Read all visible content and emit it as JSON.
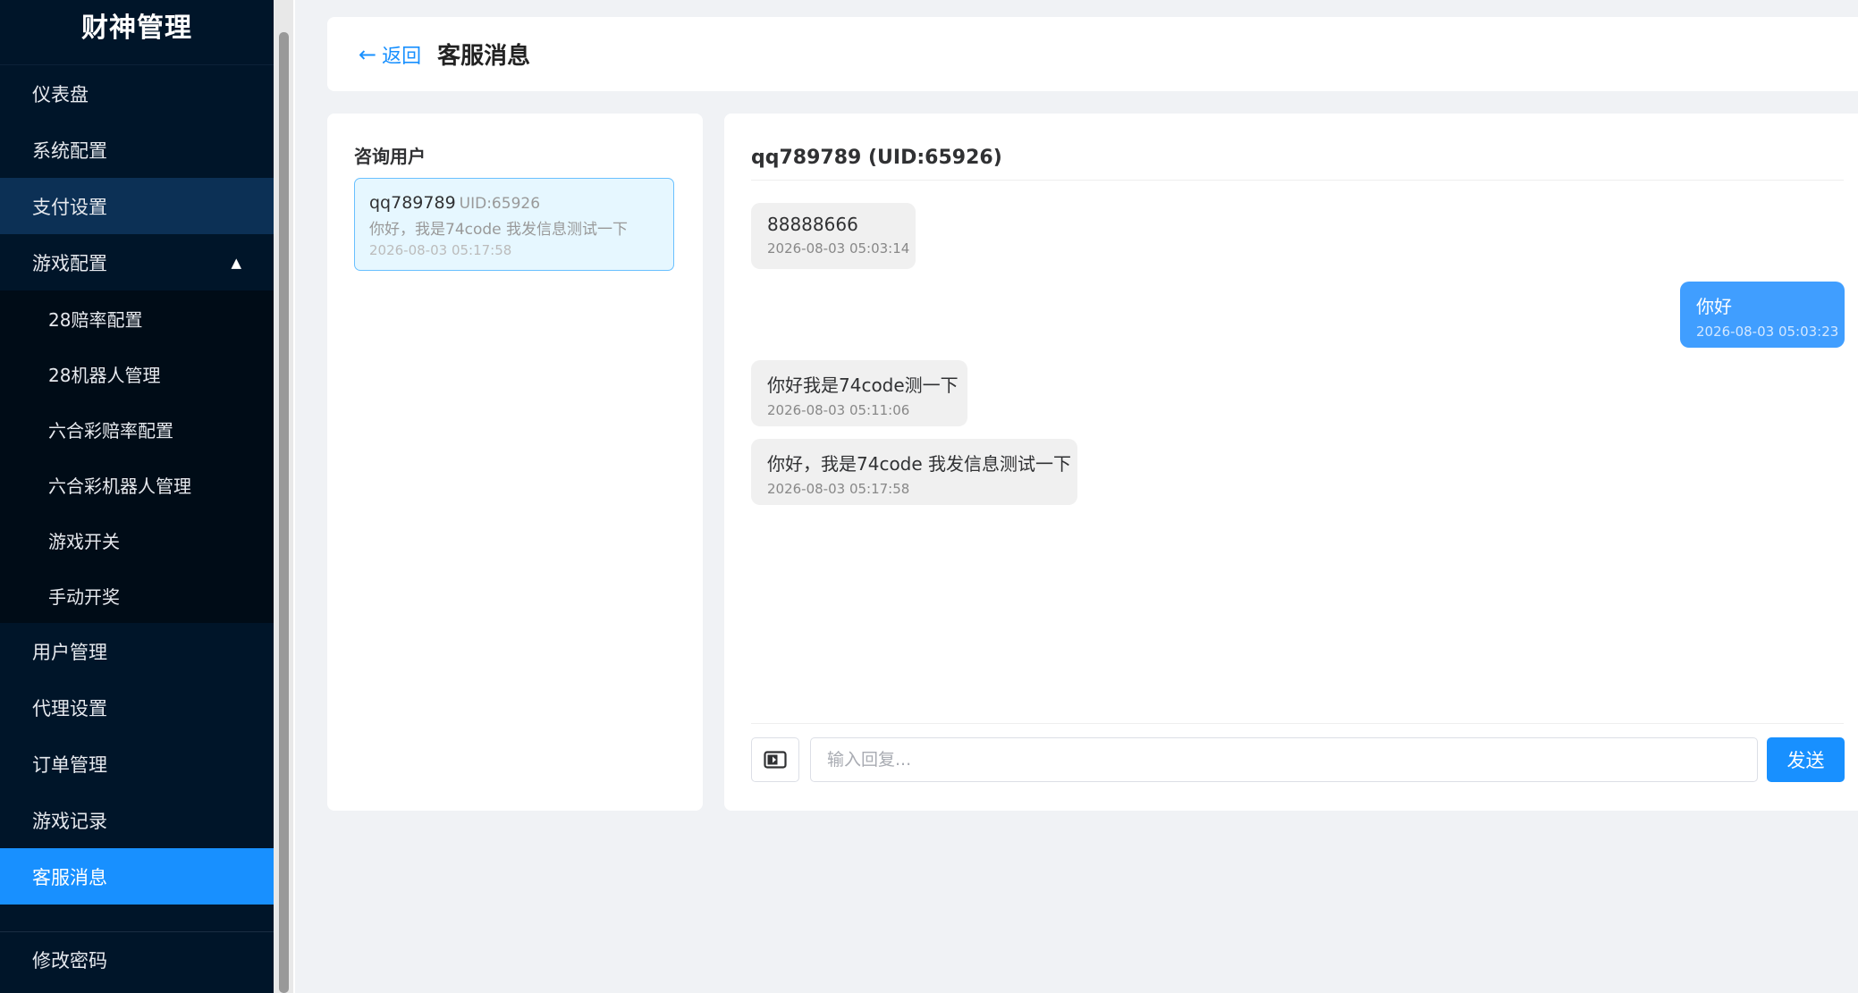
{
  "brand": {
    "title": "财神管理"
  },
  "sidebar": {
    "items": [
      {
        "label": "仪表盘"
      },
      {
        "label": "系统配置"
      },
      {
        "label": "支付设置"
      },
      {
        "label": "游戏配置",
        "caret": "▲"
      },
      {
        "label": "28赔率配置"
      },
      {
        "label": "28机器人管理"
      },
      {
        "label": "六合彩赔率配置"
      },
      {
        "label": "六合彩机器人管理"
      },
      {
        "label": "游戏开关"
      },
      {
        "label": "手动开奖"
      },
      {
        "label": "用户管理"
      },
      {
        "label": "代理设置"
      },
      {
        "label": "订单管理"
      },
      {
        "label": "游戏记录"
      },
      {
        "label": "客服消息"
      },
      {
        "label": "修改密码"
      }
    ]
  },
  "topbar": {
    "back_arrow": "←",
    "back_label": "返回",
    "title": "客服消息"
  },
  "users_panel": {
    "title": "咨询用户",
    "users": [
      {
        "name": "qq789789",
        "uid": "UID:65926",
        "preview": "你好，我是74code 我发信息测试一下",
        "time": "2026-08-03 05:17:58"
      }
    ]
  },
  "chat": {
    "header": "qq789789 (UID:65926)",
    "messages": [
      {
        "direction": "in",
        "text": "88888666",
        "time": "2026-08-03 05:03:14"
      },
      {
        "direction": "out",
        "text": "你好",
        "time": "2026-08-03 05:03:23"
      },
      {
        "direction": "in",
        "text": "你好我是74code测一下",
        "time": "2026-08-03 05:11:06"
      },
      {
        "direction": "in",
        "text": "你好，我是74code 我发信息测试一下",
        "time": "2026-08-03 05:17:58"
      }
    ],
    "input": {
      "placeholder": "输入回复...",
      "value": ""
    },
    "send_label": "发送",
    "image_button_icon": "image-icon"
  },
  "colors": {
    "sidebar_bg": "#001529",
    "accent": "#1890ff",
    "outgoing_bubble": "#409eff",
    "incoming_bubble": "#f0f0f0",
    "selected_card_bg": "#e6f7ff"
  }
}
